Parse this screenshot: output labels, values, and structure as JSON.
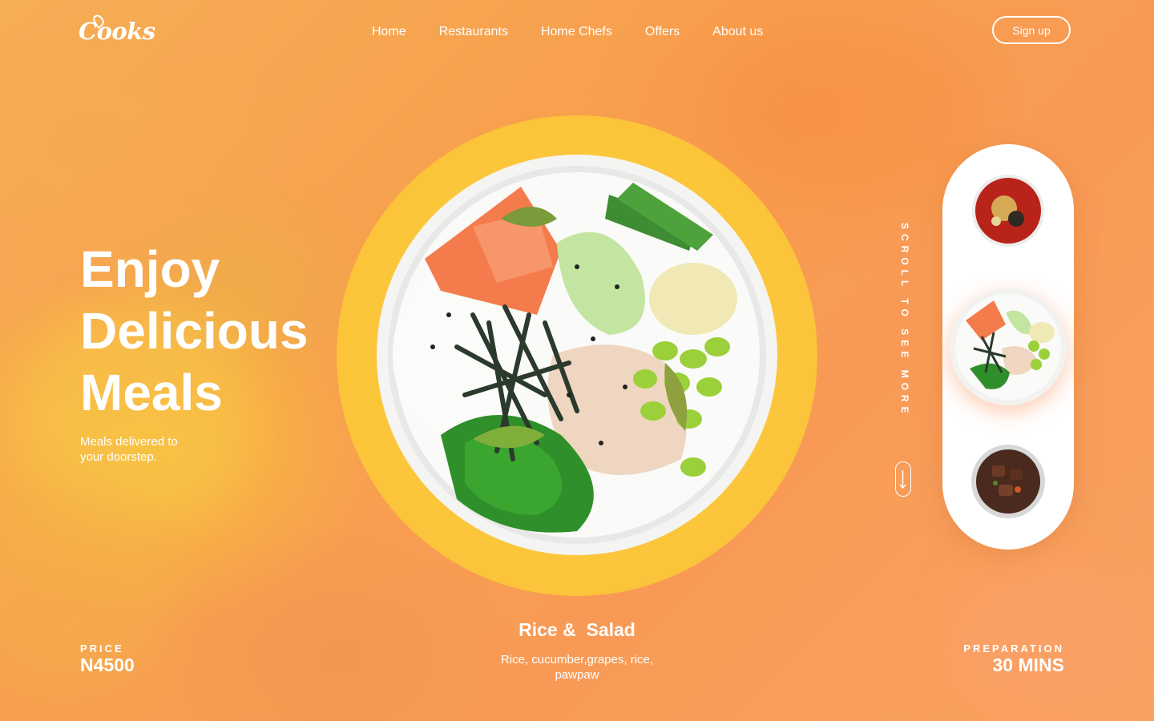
{
  "brand": {
    "logo_text": "Cooks"
  },
  "nav": {
    "items": [
      {
        "label": "Home"
      },
      {
        "label": "Restaurants"
      },
      {
        "label": "Home Chefs"
      },
      {
        "label": "Offers"
      },
      {
        "label": "About us"
      }
    ],
    "signup_label": "Sign up"
  },
  "hero": {
    "title_lines": [
      "Enjoy",
      "Delicious",
      "Meals"
    ],
    "subtitle": "Meals delivered to your doorstep."
  },
  "featured": {
    "name": "Rice &  Salad",
    "description": "Rice, cucumber,grapes, rice, pawpaw",
    "price_label": "PRICE",
    "price_value": "N4500",
    "prep_label": "PREPARATION",
    "prep_value": "30 MINS"
  },
  "side_menu": {
    "scroll_hint": "SCROLL TO SEE MORE",
    "items": [
      {
        "name": "spicy-noodle-soup-thumbnail"
      },
      {
        "name": "rice-salad-bowl-thumbnail",
        "selected": true
      },
      {
        "name": "beef-stew-thumbnail"
      }
    ]
  },
  "colors": {
    "background": "#f7a04d",
    "halo": "#fcc83c",
    "panel": "#ffffff",
    "text": "#ffffff"
  }
}
